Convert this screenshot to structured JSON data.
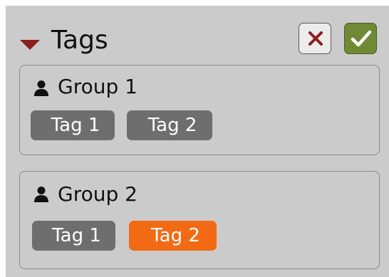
{
  "header": {
    "title": "Tags",
    "collapse_icon": "caret-down-icon",
    "cancel_icon": "close-icon",
    "confirm_icon": "check-icon"
  },
  "groups": [
    {
      "label": "Group 1",
      "icon": "user-icon",
      "tags": [
        {
          "label": "Tag 1",
          "selected": false
        },
        {
          "label": "Tag 2",
          "selected": false
        }
      ]
    },
    {
      "label": "Group 2",
      "icon": "user-icon",
      "tags": [
        {
          "label": "Tag 1",
          "selected": false
        },
        {
          "label": "Tag 2",
          "selected": true
        }
      ]
    }
  ],
  "colors": {
    "panel_bg": "#cbcbcb",
    "tag_default": "#6e6e6e",
    "tag_selected": "#f26a14",
    "confirm_bg": "#6e8a35",
    "cancel_mark": "#8e1d1d",
    "caret": "#8e1d1d"
  }
}
